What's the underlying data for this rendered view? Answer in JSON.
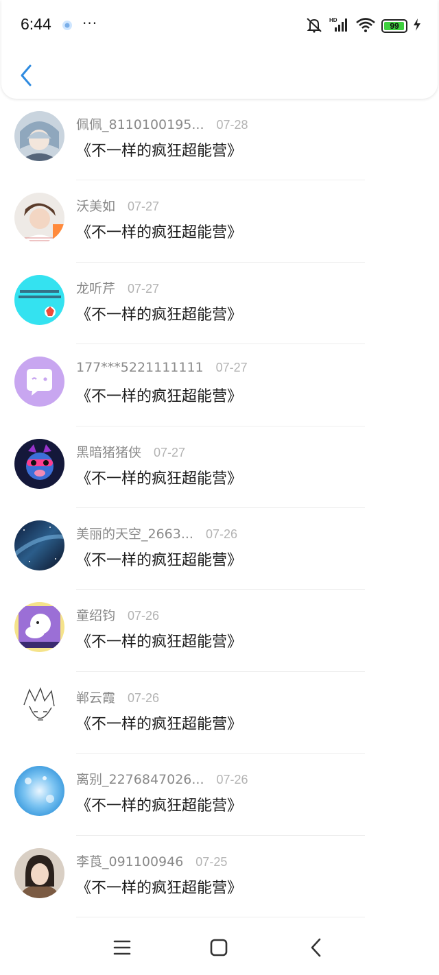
{
  "status": {
    "time": "6:44",
    "more": "···",
    "battery": "99"
  },
  "colors": {
    "accent": "#2f8be0",
    "battery_green": "#3ecf3e"
  },
  "items": [
    {
      "name": "佩佩_8110100195...",
      "date": "07-28",
      "title": "《不一样的疯狂超能营》"
    },
    {
      "name": "沃美如",
      "date": "07-27",
      "title": "《不一样的疯狂超能营》"
    },
    {
      "name": "龙听芹",
      "date": "07-27",
      "title": "《不一样的疯狂超能营》"
    },
    {
      "name": "177***5221111111",
      "date": "07-27",
      "title": "《不一样的疯狂超能营》"
    },
    {
      "name": "黑暗猪猪侠",
      "date": "07-27",
      "title": "《不一样的疯狂超能营》"
    },
    {
      "name": "美丽的天空_2663...",
      "date": "07-26",
      "title": "《不一样的疯狂超能营》"
    },
    {
      "name": "童绍钧",
      "date": "07-26",
      "title": "《不一样的疯狂超能营》"
    },
    {
      "name": "郸云霞",
      "date": "07-26",
      "title": "《不一样的疯狂超能营》"
    },
    {
      "name": "离别_2276847026...",
      "date": "07-26",
      "title": "《不一样的疯狂超能营》"
    },
    {
      "name": "李莨_091100946",
      "date": "07-25",
      "title": "《不一样的疯狂超能营》"
    }
  ]
}
